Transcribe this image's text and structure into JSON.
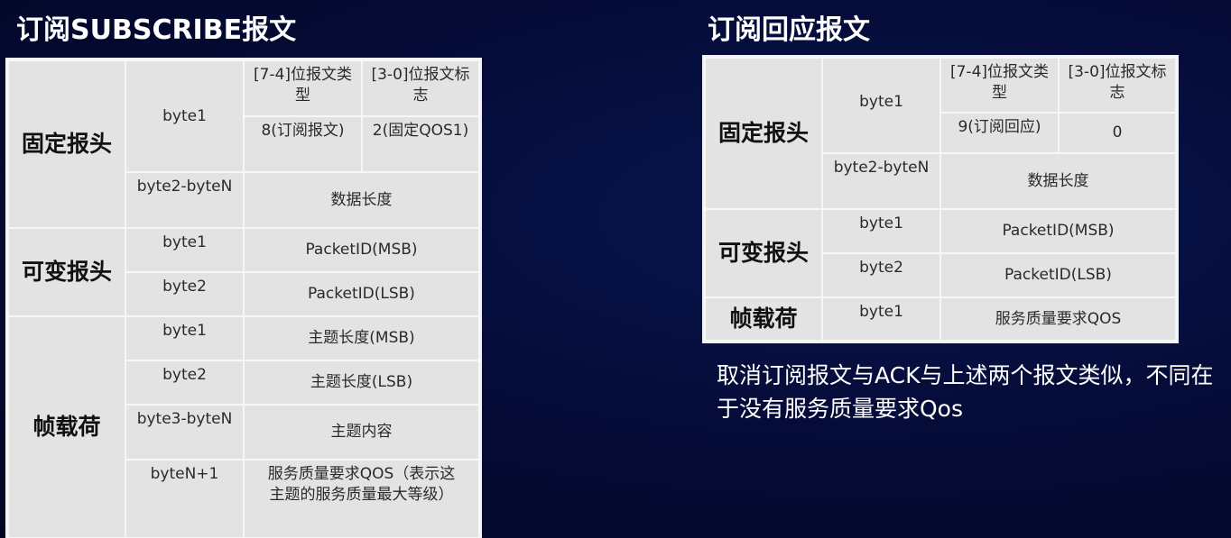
{
  "left": {
    "title": "订阅SUBSCRIBE报文",
    "header": {
      "section": "固定报头",
      "byte1": "byte1",
      "col1_head": "[7-4]位报文类型",
      "col2_head": "[3-0]位报文标志",
      "col1_val": "8(订阅报文)",
      "col2_val": "2(固定QOS1)",
      "byte2": "byte2-byteN",
      "length": "数据长度"
    },
    "variable": {
      "section": "可变报头",
      "rows": [
        {
          "byte": "byte1",
          "desc": "PacketID(MSB)"
        },
        {
          "byte": "byte2",
          "desc": "PacketID(LSB)"
        }
      ]
    },
    "payload": {
      "section": "帧载荷",
      "rows": [
        {
          "byte": "byte1",
          "desc": "主题长度(MSB)"
        },
        {
          "byte": "byte2",
          "desc": "主题长度(LSB)"
        },
        {
          "byte": "byte3-byteN",
          "desc": "主题内容"
        },
        {
          "byte": "byteN+1",
          "desc": "服务质量要求QOS（表示这主题的服务质量最大等级）"
        }
      ]
    }
  },
  "right": {
    "title": "订阅回应报文",
    "header": {
      "section": "固定报头",
      "byte1": "byte1",
      "col1_head": "[7-4]位报文类型",
      "col2_head": "[3-0]位报文标志",
      "col1_val": "9(订阅回应)",
      "col2_val": "0",
      "byte2": "byte2-byteN",
      "length": "数据长度"
    },
    "variable": {
      "section": "可变报头",
      "rows": [
        {
          "byte": "byte1",
          "desc": "PacketID(MSB)"
        },
        {
          "byte": "byte2",
          "desc": "PacketID(LSB)"
        }
      ]
    },
    "payload": {
      "section": "帧载荷",
      "rows": [
        {
          "byte": "byte1",
          "desc": "服务质量要求QOS"
        }
      ]
    }
  },
  "note": "取消订阅报文与ACK与上述两个报文类似，不同在于没有服务质量要求Qos"
}
